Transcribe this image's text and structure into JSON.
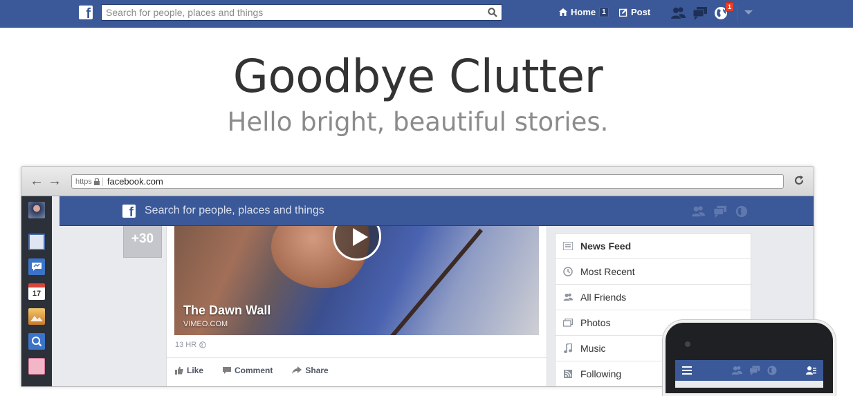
{
  "topbar": {
    "logo": "f",
    "search_placeholder": "Search for people, places and things",
    "home_label": "Home",
    "home_count": "1",
    "post_label": "Post",
    "notifications_count": "1"
  },
  "hero": {
    "title": "Goodbye Clutter",
    "subtitle": "Hello bright, beautiful stories."
  },
  "browser": {
    "scheme": "https",
    "url": "facebook.com",
    "inner_logo": "f",
    "inner_search_placeholder": "Search for people, places and things",
    "rail_calendar_day": "17"
  },
  "feed": {
    "more_photos": "+30",
    "video_title": "The Dawn Wall",
    "video_source": "VIMEO.COM",
    "timestamp": "13 HR",
    "actions": {
      "like": "Like",
      "comment": "Comment",
      "share": "Share"
    }
  },
  "sidebar": {
    "items": [
      {
        "label": "News Feed",
        "icon": "news-feed-icon"
      },
      {
        "label": "Most Recent",
        "icon": "clock-icon"
      },
      {
        "label": "All Friends",
        "icon": "friends-icon"
      },
      {
        "label": "Photos",
        "icon": "photos-icon"
      },
      {
        "label": "Music",
        "icon": "music-icon"
      },
      {
        "label": "Following",
        "icon": "rss-icon"
      }
    ]
  },
  "colors": {
    "brand": "#3b5998",
    "background": "#e9eaed",
    "badge": "#f03d25"
  }
}
